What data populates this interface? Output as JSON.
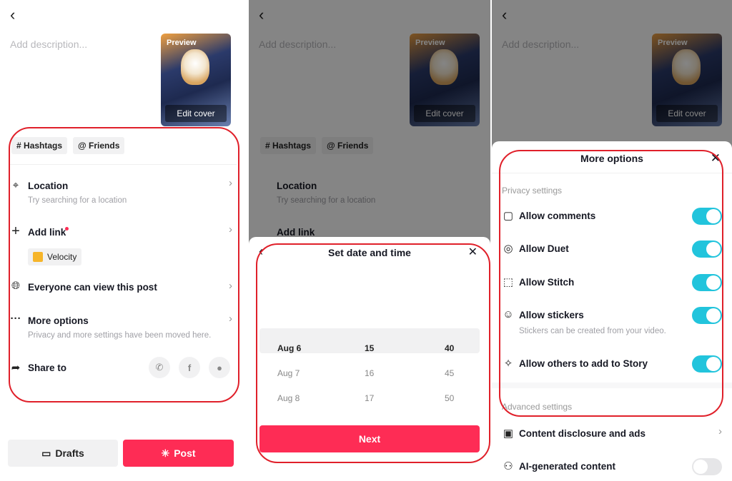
{
  "compose": {
    "description_placeholder": "Add description...",
    "thumbnail": {
      "preview_label": "Preview",
      "edit_cover_label": "Edit cover"
    },
    "chips": [
      {
        "icon": "#",
        "label": "Hashtags"
      },
      {
        "icon": "@",
        "label": "Friends"
      }
    ],
    "rows": {
      "location": {
        "title": "Location",
        "subtitle": "Try searching for a location"
      },
      "add_link": {
        "title": "Add link",
        "tag": "Velocity"
      },
      "visibility": {
        "title": "Everyone can view this post"
      },
      "more_options": {
        "title": "More options",
        "subtitle": "Privacy and more settings have been moved here."
      },
      "share_to": {
        "title": "Share to",
        "targets": [
          "whatsapp",
          "facebook",
          "message"
        ]
      }
    },
    "drafts_label": "Drafts",
    "post_label": "Post",
    "accent": "#fe2c55"
  },
  "schedule": {
    "title": "Set date and time",
    "dates": [
      "Aug 6",
      "Aug 7",
      "Aug 8"
    ],
    "hours": [
      "15",
      "16",
      "17"
    ],
    "minutes": [
      "40",
      "45",
      "50"
    ],
    "selected": {
      "date": "Aug 6",
      "hour": "15",
      "minute": "40"
    },
    "next_label": "Next"
  },
  "more_options": {
    "title": "More options",
    "privacy_header": "Privacy settings",
    "toggles": [
      {
        "label": "Allow comments",
        "on": true
      },
      {
        "label": "Allow Duet",
        "on": true
      },
      {
        "label": "Allow Stitch",
        "on": true
      },
      {
        "label": "Allow stickers",
        "subtitle": "Stickers can be created from your video.",
        "on": true
      },
      {
        "label": "Allow others to add to Story",
        "on": true
      }
    ],
    "advanced_header": "Advanced settings",
    "content_disclosure": "Content disclosure and ads",
    "ai_generated": {
      "label": "AI-generated content",
      "on": false
    },
    "toggle_color": "#22c4dc"
  }
}
